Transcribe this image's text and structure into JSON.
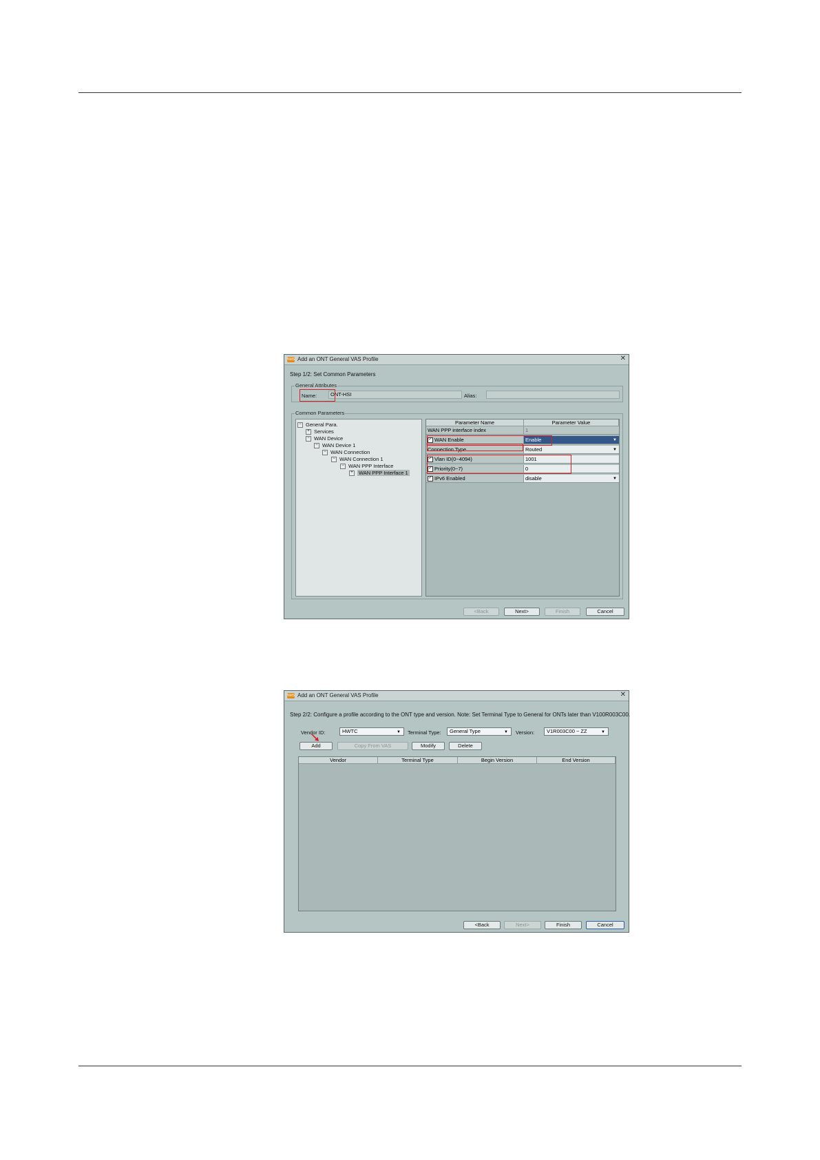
{
  "dialog1": {
    "title": "Add an ONT General VAS Profile",
    "step": "Step 1/2: Set Common Parameters",
    "general_attributes": {
      "legend": "General Attributes",
      "name_label": "Name:",
      "name_value": "ONT-HSI",
      "alias_label": "Alias:",
      "alias_value": ""
    },
    "common_parameters": {
      "legend": "Common Parameters",
      "tree": [
        {
          "label": "General Para.",
          "expander": "−"
        },
        {
          "label": "Services",
          "expander": "+"
        },
        {
          "label": "WAN Device",
          "expander": "−"
        },
        {
          "label": "WAN Device 1",
          "expander": "−"
        },
        {
          "label": "WAN Connection",
          "expander": "−"
        },
        {
          "label": "WAN Connection 1",
          "expander": "−"
        },
        {
          "label": "WAN PPP Interface",
          "expander": "−"
        },
        {
          "label": "WAN PPP Interface 1",
          "expander": "+"
        }
      ],
      "table_headers": [
        "Parameter Name",
        "Parameter Value"
      ],
      "rows": [
        {
          "name": "WAN PPP interface index",
          "value": "1",
          "checked": false
        },
        {
          "name": "WAN Enable",
          "value": "Enable",
          "checked": true
        },
        {
          "name": "Connection Type",
          "value": "Routed",
          "checked": false
        },
        {
          "name": "Vlan ID(0~4094)",
          "value": "1001",
          "checked": true
        },
        {
          "name": "Priority(0~7)",
          "value": "0",
          "checked": true
        },
        {
          "name": "IPv6 Enabled",
          "value": "disable",
          "checked": true
        }
      ]
    },
    "buttons": {
      "back": "<Back",
      "next": "Next>",
      "finish": "Finish",
      "cancel": "Cancel"
    }
  },
  "dialog2": {
    "title": "Add an ONT General VAS Profile",
    "step": "Step 2/2: Configure a profile according to the ONT type and version. Note: Set Terminal Type to General for ONTs later than V100R003C00.",
    "vendor_label": "Vendor ID:",
    "vendor_value": "HWTC",
    "terminal_label": "Terminal Type:",
    "terminal_value": "General Type",
    "version_label": "Version:",
    "version_value": "V1R003C00 ~ ZZ",
    "actions": {
      "add": "Add",
      "copy": "Copy From VAS",
      "modify": "Modify",
      "delete": "Delete"
    },
    "table_headers": [
      "Vendor",
      "Terminal Type",
      "Begin Version",
      "End Version"
    ],
    "buttons": {
      "back": "<Back",
      "next": "Next>",
      "finish": "Finish",
      "cancel": "Cancel"
    }
  },
  "colors": {
    "highlight_box": "#d81f26",
    "selection": "#34578a",
    "dialog_bg": "#b5c5c3"
  }
}
